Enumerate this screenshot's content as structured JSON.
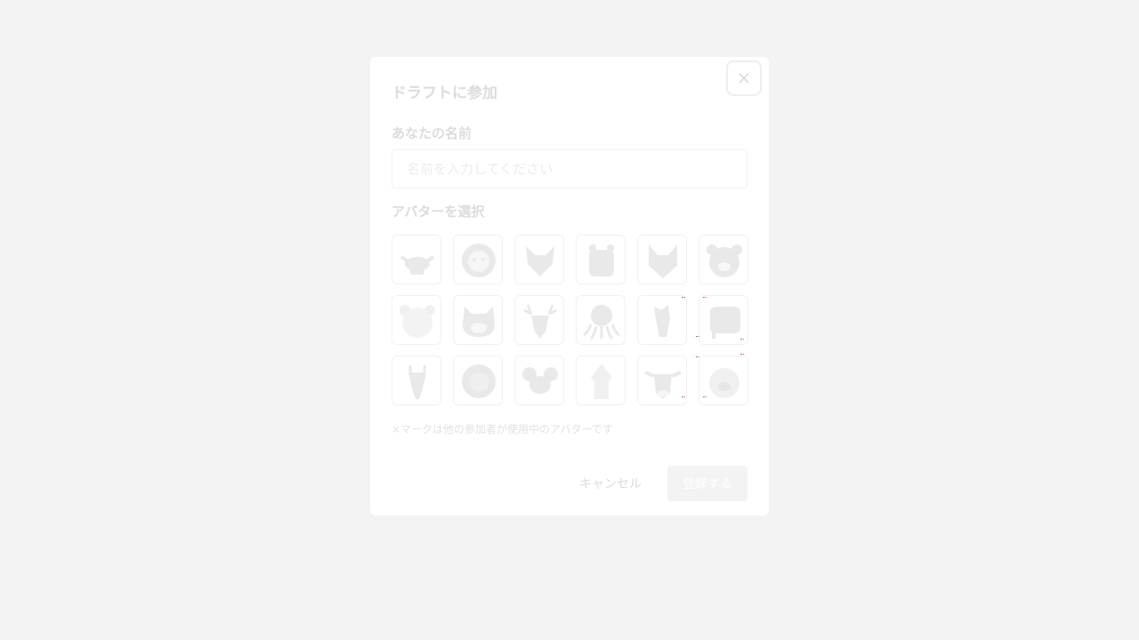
{
  "dialog": {
    "title": "ドラフトに参加",
    "close_icon": "close-icon",
    "name_label": "あなたの名前",
    "name_value": "",
    "name_placeholder": "名前を入力してください",
    "avatar_label": "アバターを選択",
    "avatars": [
      {
        "id": "bull",
        "icon": "bull-icon",
        "in_use": false
      },
      {
        "id": "lion",
        "icon": "lion-icon",
        "in_use": false
      },
      {
        "id": "fox",
        "icon": "fox-icon",
        "in_use": false
      },
      {
        "id": "hippo",
        "icon": "hippo-icon",
        "in_use": false
      },
      {
        "id": "wolf",
        "icon": "wolf-icon",
        "in_use": false
      },
      {
        "id": "bear",
        "icon": "bear-icon",
        "in_use": false
      },
      {
        "id": "polar-bear",
        "icon": "polar-bear-icon",
        "in_use": false
      },
      {
        "id": "cat",
        "icon": "cat-icon",
        "in_use": false
      },
      {
        "id": "deer",
        "icon": "deer-icon",
        "in_use": false
      },
      {
        "id": "octopus",
        "icon": "octopus-icon",
        "in_use": false
      },
      {
        "id": "horse",
        "icon": "horse-icon",
        "in_use": false
      },
      {
        "id": "elephant",
        "icon": "elephant-icon",
        "in_use": false
      },
      {
        "id": "giraffe",
        "icon": "giraffe-icon",
        "in_use": false
      },
      {
        "id": "lion2",
        "icon": "lion-mane-icon",
        "in_use": false
      },
      {
        "id": "mouse",
        "icon": "mouse-icon",
        "in_use": false
      },
      {
        "id": "squid",
        "icon": "squid-icon",
        "in_use": false
      },
      {
        "id": "cow",
        "icon": "cow-icon",
        "in_use": false
      },
      {
        "id": "pig",
        "icon": "pig-icon",
        "in_use": false
      }
    ],
    "note": "×マークは他の参加者が使用中のアバターです",
    "cancel_label": "キャンセル",
    "submit_label": "登録する"
  },
  "colors": {
    "icon_fill": "#e9e9e9",
    "overlay_bg": "#f3f3f3",
    "selection_marker": "#c4392b"
  }
}
